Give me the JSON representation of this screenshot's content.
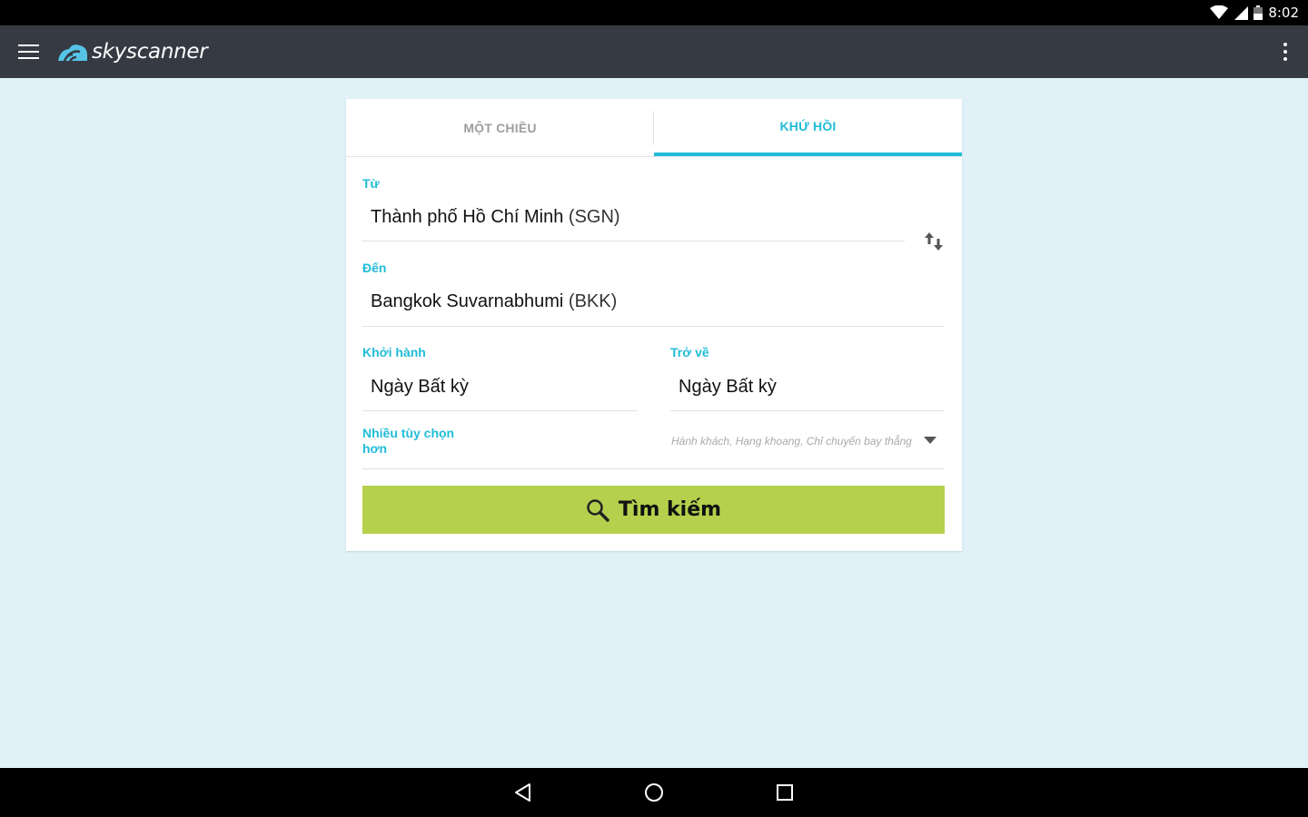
{
  "status_bar": {
    "time": "8:02"
  },
  "app_bar": {
    "brand": "skyscanner"
  },
  "tabs": {
    "one_way": "MỘT CHIỀU",
    "round_trip": "KHỨ HỒI"
  },
  "from": {
    "label": "Từ",
    "city": "Thành phố Hồ Chí Minh",
    "code": "(SGN)"
  },
  "to": {
    "label": "Đến",
    "city": "Bangkok Suvarnabhumi",
    "code": "(BKK)"
  },
  "depart": {
    "label": "Khởi hành",
    "value": "Ngày Bất kỳ"
  },
  "return": {
    "label": "Trở về",
    "value": "Ngày Bất kỳ"
  },
  "options": {
    "label": "Nhiều tùy chọn hơn",
    "hint": "Hành khách, Hạng khoang, Chỉ chuyến bay thẳng"
  },
  "search": {
    "label": "Tìm kiếm"
  },
  "colors": {
    "accent": "#20bcd8",
    "search_button": "#b5d04c",
    "app_bar": "#353a43",
    "background": "#e1f1f8"
  }
}
